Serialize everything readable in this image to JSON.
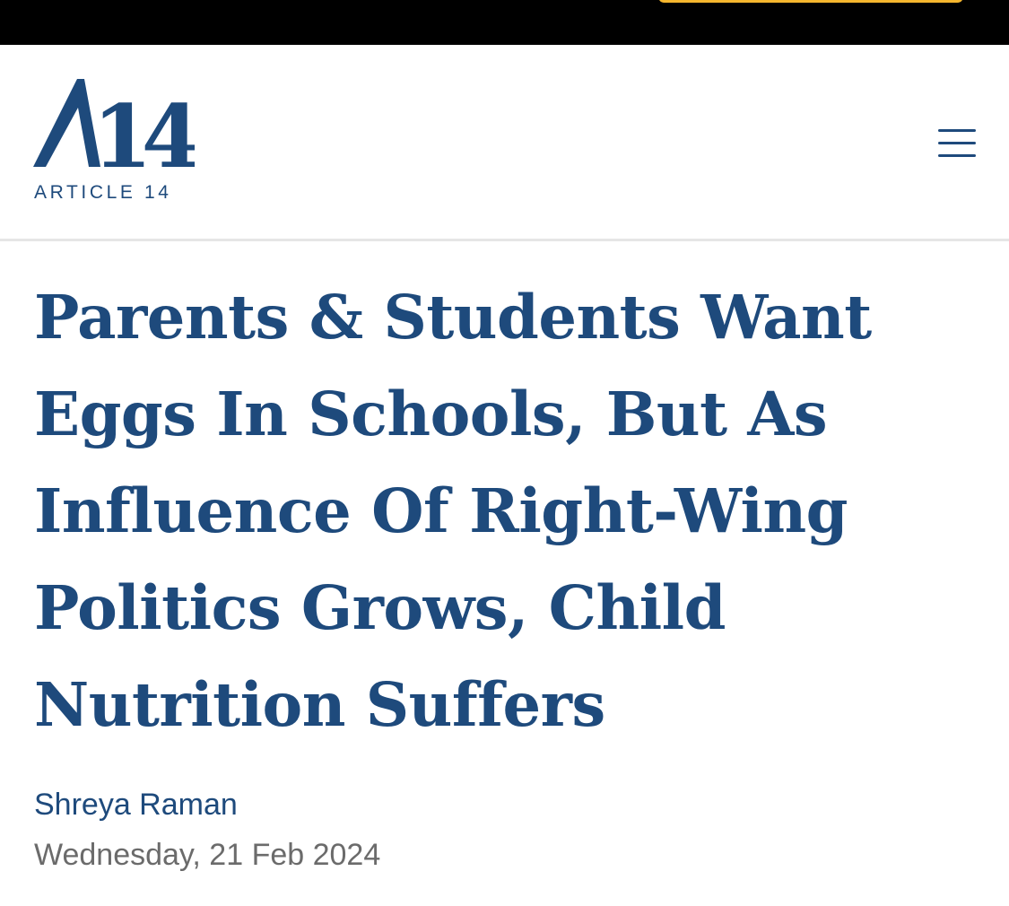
{
  "colors": {
    "brand": "#1e4a7c",
    "accent": "#f5b62e",
    "top_bar": "#000000",
    "date_text": "#6b6b6b",
    "divider": "#e6e6e6"
  },
  "header": {
    "logo_mark": "A14",
    "logo_text": "ARTICLE 14",
    "menu_icon": "hamburger-menu-icon"
  },
  "article": {
    "headline": "Parents & Students Want Eggs In Schools, But As Influence Of Right-Wing Politics Grows, Child Nutrition Suffers",
    "author": "Shreya Raman",
    "date": "Wednesday, 21 Feb 2024"
  }
}
